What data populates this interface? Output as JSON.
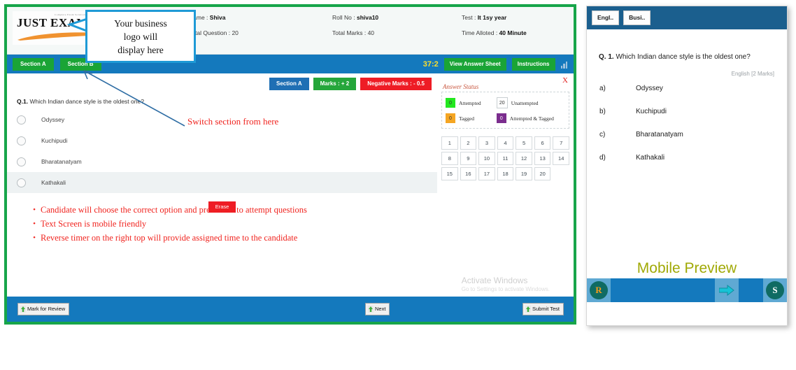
{
  "desktop": {
    "logo": {
      "word": "JUST EXAM",
      "tagline": "Complete Exam Solution"
    },
    "callout": {
      "line1": "Your business",
      "line2": "logo  will",
      "line3": "display here"
    },
    "header": {
      "name_label": "Name :",
      "name_value": "Shiva",
      "roll_label": "Roll No :",
      "roll_value": "shiva10",
      "test_label": "Test :",
      "test_value": "It 1sy year",
      "total_question_label": "Total Question :",
      "total_question_value": "20",
      "total_marks_label": "Total Marks :",
      "total_marks_value": "40",
      "time_alloted_label": "Time Alloted :",
      "time_alloted_value": "40 Minute"
    },
    "section_bar": {
      "tabs": [
        "Section A",
        "Section B"
      ],
      "timer": "37:2",
      "view_answer_sheet": "View Answer Sheet",
      "instructions": "Instructions"
    },
    "meta_chips": {
      "section": "Section A",
      "marks": "Marks : + 2",
      "negative_marks": "Negative Marks : - 0.5"
    },
    "question": {
      "number": "Q.1.",
      "text": "Which Indian dance style is the oldest one?",
      "options": [
        "Odyssey",
        "Kuchipudi",
        "Bharatanatyam",
        "Kathakali"
      ],
      "erase_label": "Erase"
    },
    "annotations": {
      "switch_section": "Switch section from here",
      "notes": [
        "Candidate will choose the correct option and press next to attempt questions",
        "Text Screen is mobile friendly",
        "Reverse timer on the right top will provide assigned time to the candidate"
      ]
    },
    "answer_status": {
      "title": "Answer Status",
      "close": "X",
      "legend": [
        {
          "count": "0",
          "label": "Attempted",
          "color": "#23e81f"
        },
        {
          "count": "20",
          "label": "Unattempted",
          "color": "#ffffff"
        },
        {
          "count": "0",
          "label": "Tagged",
          "color": "#f5a623"
        },
        {
          "count": "0",
          "label": "Attempted & Tagged",
          "color": "#7b2d8e"
        }
      ],
      "question_numbers": [
        "1",
        "2",
        "3",
        "4",
        "5",
        "6",
        "7",
        "8",
        "9",
        "10",
        "11",
        "12",
        "13",
        "14",
        "15",
        "16",
        "17",
        "18",
        "19",
        "20"
      ]
    },
    "watermark": {
      "title": "Activate Windows",
      "subtitle": "Go to Settings to activate Windows."
    },
    "bottom_bar": {
      "mark_for_review": "Mark for Review",
      "next": "Next",
      "submit_test": "Submit Test"
    }
  },
  "mobile": {
    "tabs": [
      "Engl..",
      "Busi.."
    ],
    "question_number": "Q. 1.",
    "question_text": "Which Indian dance style is the oldest one?",
    "marks_label": "English [2 Marks]",
    "options": [
      {
        "key": "a)",
        "text": "Odyssey"
      },
      {
        "key": "b)",
        "text": "Kuchipudi"
      },
      {
        "key": "c)",
        "text": "Bharatanatyam"
      },
      {
        "key": "d)",
        "text": "Kathakali"
      }
    ],
    "preview_label": "Mobile Preview",
    "bottom": {
      "review_icon": "R",
      "next_icon": "next-arrow-icon",
      "submit_icon": "S"
    }
  },
  "colors": {
    "frame_green": "#17a54a",
    "bar_blue": "#1479bd",
    "tab_green": "#1aa436",
    "timer_yellow": "#ffdf2b",
    "negative_red": "#ee1c25",
    "annotation_red": "#f0241f",
    "callout_blue": "#1e9ad6",
    "mobile_header_blue": "#1b5f8e",
    "preview_olive": "#a0a906"
  }
}
